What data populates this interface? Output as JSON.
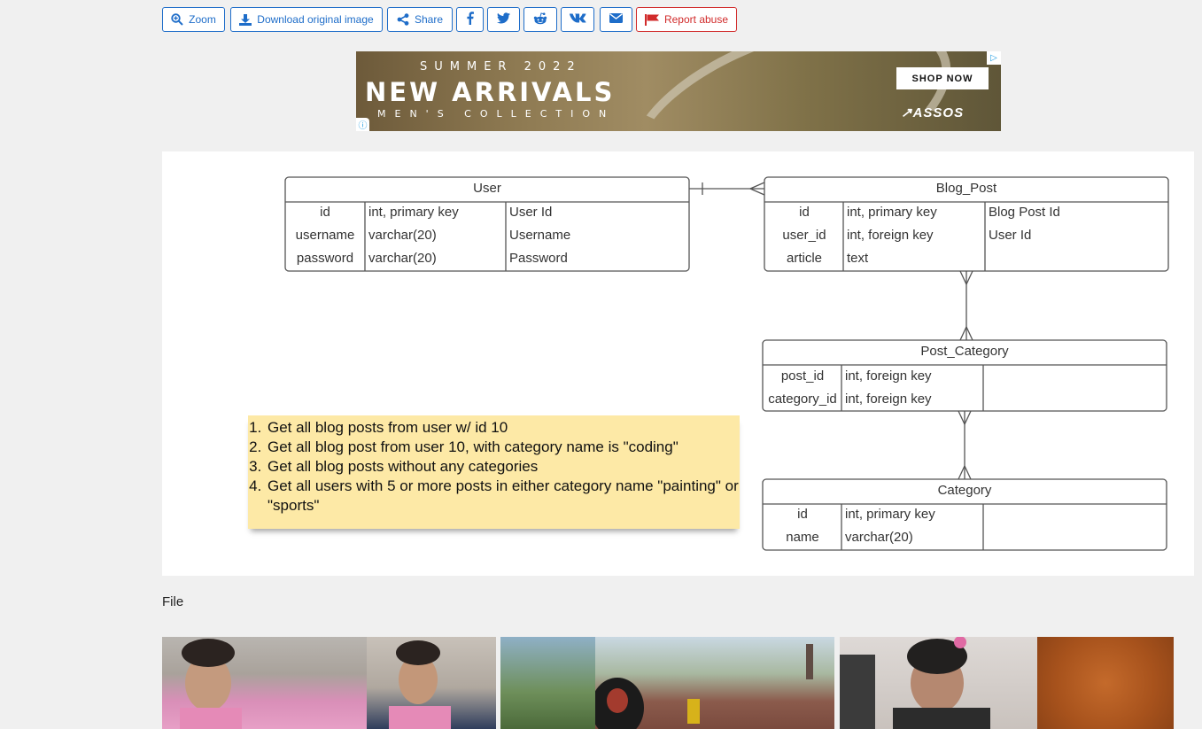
{
  "toolbar": {
    "zoom_label": "Zoom",
    "download_label": "Download original image",
    "share_label": "Share",
    "report_label": "Report abuse",
    "share_icons": [
      "facebook-icon",
      "twitter-icon",
      "reddit-icon",
      "vk-icon",
      "email-icon"
    ]
  },
  "ad": {
    "line1": "SUMMER 2022",
    "line2": "NEW ARRIVALS",
    "line3": "MEN'S COLLECTION",
    "cta": "SHOP NOW",
    "brand": "↗ASSOS"
  },
  "diagram": {
    "tables": {
      "user": {
        "title": "User",
        "rows": [
          [
            "id",
            "int, primary key",
            "User Id"
          ],
          [
            "username",
            "varchar(20)",
            "Username"
          ],
          [
            "password",
            "varchar(20)",
            "Password"
          ]
        ]
      },
      "blog_post": {
        "title": "Blog_Post",
        "rows": [
          [
            "id",
            "int, primary key",
            "Blog Post Id"
          ],
          [
            "user_id",
            "int, foreign key",
            "User Id"
          ],
          [
            "article",
            "text",
            ""
          ]
        ]
      },
      "post_category": {
        "title": "Post_Category",
        "rows": [
          [
            "post_id",
            "int, foreign key",
            ""
          ],
          [
            "category_id",
            "int, foreign key",
            ""
          ]
        ]
      },
      "category": {
        "title": "Category",
        "rows": [
          [
            "id",
            "int, primary key",
            ""
          ],
          [
            "name",
            "varchar(20)",
            ""
          ]
        ]
      }
    },
    "tasks": [
      "Get all blog posts from user w/ id 10",
      "Get all blog post from user 10, with category name is \"coding\"",
      "Get all blog posts without any categories",
      "Get all users with 5 or more posts in either category name \"painting\" or \"sports\""
    ]
  },
  "file_label": "File",
  "colors": {
    "accent": "#1e6dc9",
    "danger": "#d12b2b",
    "note_bg": "#fde9a6",
    "page_bg": "#f0f0f0"
  }
}
